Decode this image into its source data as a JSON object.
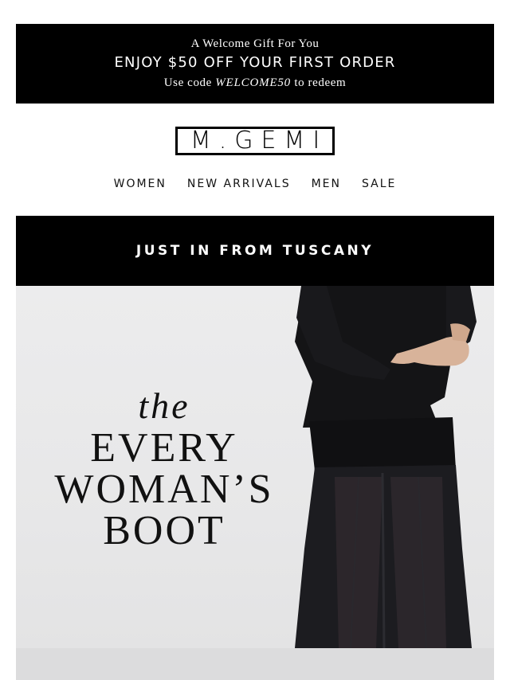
{
  "promo": {
    "kicker": "A Welcome Gift For You",
    "headline": "ENJOY $50 OFF YOUR FIRST ORDER",
    "code_prefix": "Use code",
    "code": "WELCOME50",
    "code_suffix": "to redeem"
  },
  "brand": {
    "logo_text": "M.GEMI"
  },
  "nav": {
    "items": [
      {
        "label": "WOMEN"
      },
      {
        "label": "NEW ARRIVALS"
      },
      {
        "label": "MEN"
      },
      {
        "label": "SALE"
      }
    ]
  },
  "banner": {
    "text": "JUST IN FROM TUSCANY"
  },
  "hero": {
    "line_the": "the",
    "line_1": "EVERY",
    "line_2": "WOMAN’S",
    "line_3": "BOOT",
    "image_alt": "model-wearing-black-sheer-dress"
  },
  "colors": {
    "promo_bg": "#000000",
    "banner_bg": "#000000",
    "hero_bg": "#e9e9ea",
    "text": "#111111"
  }
}
